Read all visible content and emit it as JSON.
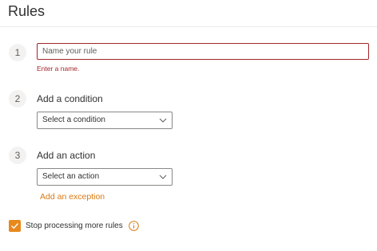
{
  "header": {
    "title": "Rules"
  },
  "steps": [
    {
      "number": "1",
      "name_input": {
        "placeholder": "Name your rule",
        "value": ""
      },
      "error": "Enter a name."
    },
    {
      "number": "2",
      "label": "Add a condition",
      "dropdown": {
        "selected": "Select a condition",
        "icon": "chevron-down-icon"
      }
    },
    {
      "number": "3",
      "label": "Add an action",
      "dropdown": {
        "selected": "Select an action",
        "icon": "chevron-down-icon"
      },
      "exception_link": "Add an exception"
    }
  ],
  "stop_processing": {
    "label": "Stop processing more rules",
    "checked": true,
    "info_icon": "info-icon"
  },
  "colors": {
    "accent": "#e8891d",
    "link": "#d97a14",
    "error": "#a4262c"
  }
}
